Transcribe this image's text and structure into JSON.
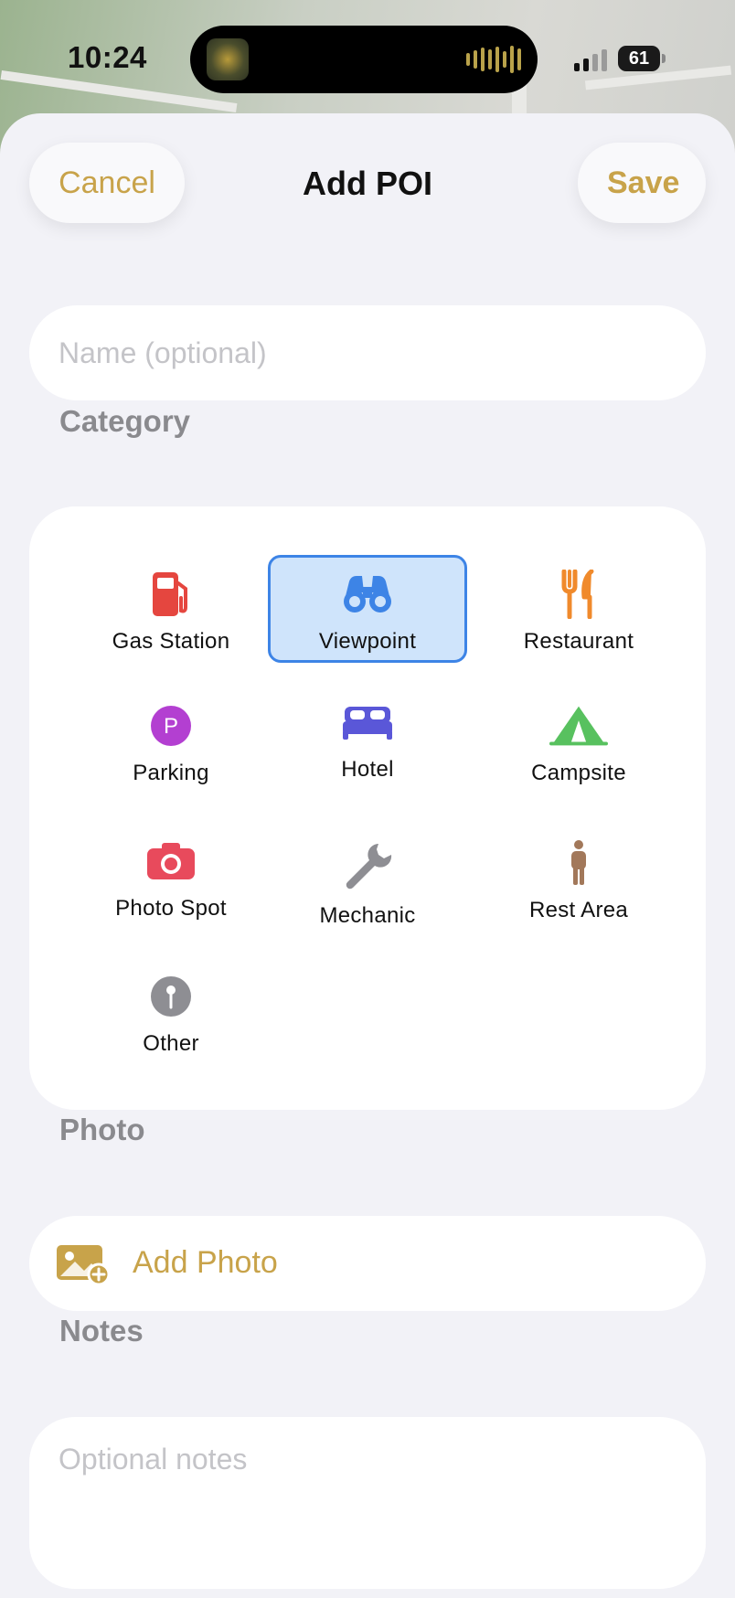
{
  "status_bar": {
    "time": "10:24",
    "battery": "61"
  },
  "header": {
    "title": "Add POI",
    "cancel_label": "Cancel",
    "save_label": "Save"
  },
  "name_field": {
    "placeholder": "Name (optional)",
    "value": ""
  },
  "category": {
    "label": "Category",
    "selected": "Viewpoint",
    "items": [
      {
        "label": "Gas Station",
        "icon": "gas-pump-icon",
        "color": "#e5463f"
      },
      {
        "label": "Viewpoint",
        "icon": "binoculars-icon",
        "color": "#3d84e6"
      },
      {
        "label": "Restaurant",
        "icon": "fork-knife-icon",
        "color": "#f08a2c"
      },
      {
        "label": "Parking",
        "icon": "parking-icon",
        "color": "#b33fd1"
      },
      {
        "label": "Hotel",
        "icon": "bed-icon",
        "color": "#5a57d8"
      },
      {
        "label": "Campsite",
        "icon": "tent-icon",
        "color": "#58c15f"
      },
      {
        "label": "Photo Spot",
        "icon": "camera-icon",
        "color": "#e84a5c"
      },
      {
        "label": "Mechanic",
        "icon": "wrench-icon",
        "color": "#8e8e93"
      },
      {
        "label": "Rest Area",
        "icon": "person-icon",
        "color": "#a2785a"
      },
      {
        "label": "Other",
        "icon": "pin-icon",
        "color": "#8e8e93"
      }
    ]
  },
  "photo": {
    "label": "Photo",
    "add_label": "Add Photo"
  },
  "notes": {
    "label": "Notes",
    "placeholder": "Optional notes",
    "value": ""
  },
  "colors": {
    "accent": "#c8a34a",
    "selection": "#3d84e6",
    "background": "#f2f2f7"
  }
}
